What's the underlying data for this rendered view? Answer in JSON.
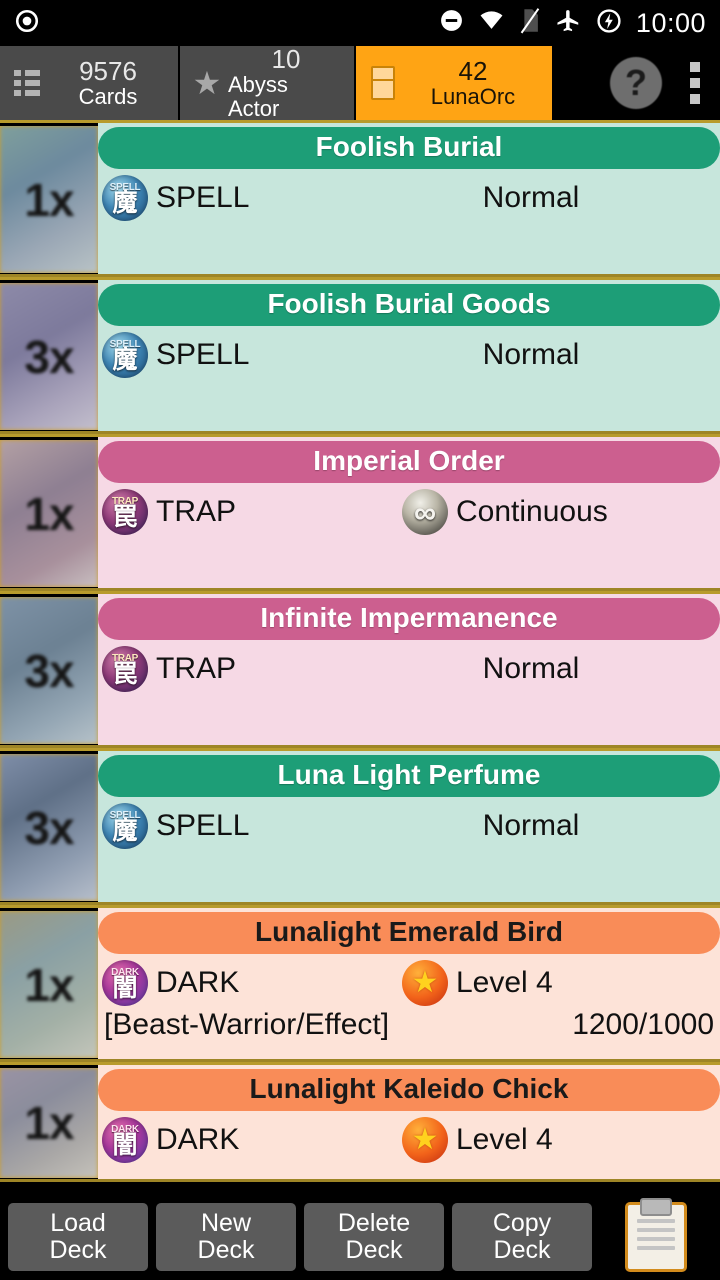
{
  "status_bar": {
    "left_icon": "record-dot-icon",
    "icons": [
      "do-not-disturb-icon",
      "wifi-icon",
      "no-sim-icon",
      "airplane-mode-icon",
      "battery-charging-icon"
    ],
    "clock": "10:00"
  },
  "tabs": [
    {
      "icon": "list-icon",
      "count": "9576",
      "label": "Cards",
      "active": false
    },
    {
      "icon": "star-icon",
      "count": "10",
      "label": "Abyss Actor",
      "active": false
    },
    {
      "icon": "deck-icon",
      "count": "42",
      "label": "LunaOrc",
      "active": true
    }
  ],
  "tab_actions": [
    {
      "icon": "help-icon",
      "label": "?"
    },
    {
      "icon": "overflow-menu-icon",
      "label": ""
    }
  ],
  "colors": {
    "accent_orange": "#ffa414",
    "spell_title": "#1d9e77",
    "spell_body": "#c7e6dc",
    "trap_title": "#cc5f8f",
    "trap_body": "#f6d9e5",
    "monster_title": "#f98c58",
    "monster_body": "#fde3d8",
    "divider_gold": "#cfa02a"
  },
  "cards": [
    {
      "kind": "spell",
      "count": "1x",
      "name": "Foolish Burial",
      "attribute_icon": "spell-badge-icon",
      "attribute_top": "SPELL",
      "attribute_kanji": "魔",
      "attribute": "SPELL",
      "right_icon": "",
      "right_text": "Normal",
      "typeline": "",
      "atkdef": ""
    },
    {
      "kind": "spell",
      "count": "3x",
      "name": "Foolish Burial Goods",
      "attribute_icon": "spell-badge-icon",
      "attribute_top": "SPELL",
      "attribute_kanji": "魔",
      "attribute": "SPELL",
      "right_icon": "",
      "right_text": "Normal",
      "typeline": "",
      "atkdef": ""
    },
    {
      "kind": "trap",
      "count": "1x",
      "name": "Imperial Order",
      "attribute_icon": "trap-badge-icon",
      "attribute_top": "TRAP",
      "attribute_kanji": "罠",
      "attribute": "TRAP",
      "right_icon": "continuous-icon",
      "right_text": "Continuous",
      "typeline": "",
      "atkdef": ""
    },
    {
      "kind": "trap",
      "count": "3x",
      "name": "Infinite Impermanence",
      "attribute_icon": "trap-badge-icon",
      "attribute_top": "TRAP",
      "attribute_kanji": "罠",
      "attribute": "TRAP",
      "right_icon": "",
      "right_text": "Normal",
      "typeline": "",
      "atkdef": ""
    },
    {
      "kind": "spell",
      "count": "3x",
      "name": "Luna Light Perfume",
      "attribute_icon": "spell-badge-icon",
      "attribute_top": "SPELL",
      "attribute_kanji": "魔",
      "attribute": "SPELL",
      "right_icon": "",
      "right_text": "Normal",
      "typeline": "",
      "atkdef": ""
    },
    {
      "kind": "monster",
      "count": "1x",
      "name": "Lunalight Emerald Bird",
      "attribute_icon": "dark-badge-icon",
      "attribute_top": "DARK",
      "attribute_kanji": "闇",
      "attribute": "DARK",
      "right_icon": "level-star-icon",
      "right_text": "Level 4",
      "typeline": "[Beast-Warrior/Effect]",
      "atkdef": "1200/1000"
    },
    {
      "kind": "monster",
      "count": "1x",
      "name": "Lunalight Kaleido Chick",
      "attribute_icon": "dark-badge-icon",
      "attribute_top": "DARK",
      "attribute_kanji": "闇",
      "attribute": "DARK",
      "right_icon": "level-star-icon",
      "right_text": "Level 4",
      "typeline": "",
      "atkdef": ""
    }
  ],
  "bottom_bar": {
    "buttons": [
      {
        "line1": "Load",
        "line2": "Deck"
      },
      {
        "line1": "New",
        "line2": "Deck"
      },
      {
        "line1": "Delete",
        "line2": "Deck"
      },
      {
        "line1": "Copy",
        "line2": "Deck"
      }
    ],
    "clipboard_icon": "clipboard-icon"
  }
}
